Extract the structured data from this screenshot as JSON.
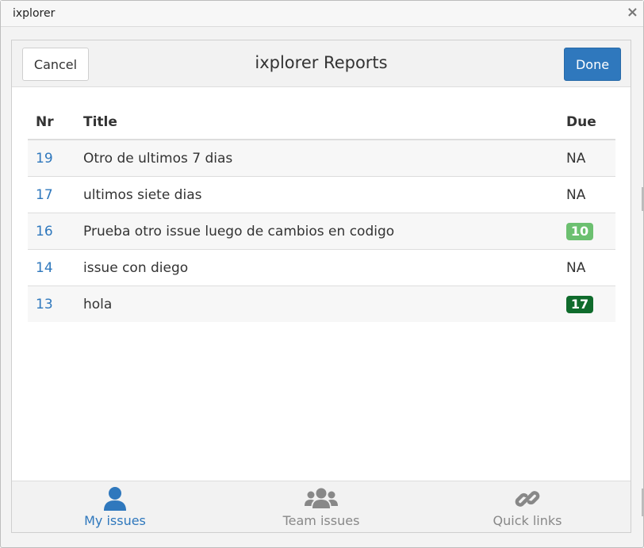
{
  "window": {
    "title": "ixplorer",
    "close_label": "×"
  },
  "modal": {
    "title": "ixplorer Reports",
    "cancel_label": "Cancel",
    "done_label": "Done"
  },
  "table": {
    "headers": {
      "nr": "Nr",
      "title": "Title",
      "due": "Due"
    },
    "rows": [
      {
        "nr": "19",
        "title": "Otro de ultimos 7 dias",
        "due": "NA"
      },
      {
        "nr": "17",
        "title": "ultimos siete dias",
        "due": "NA"
      },
      {
        "nr": "16",
        "title": "Prueba otro issue luego de cambios en codigo",
        "due": "10",
        "due_badge_color": "#6cc070"
      },
      {
        "nr": "14",
        "title": "issue con diego",
        "due": "NA"
      },
      {
        "nr": "13",
        "title": "hola",
        "due": "17",
        "due_badge_color": "#0f6b2c"
      }
    ]
  },
  "tabs": [
    {
      "label": "My issues",
      "icon": "user-icon",
      "active": true
    },
    {
      "label": "Team issues",
      "icon": "users-icon",
      "active": false
    },
    {
      "label": "Quick links",
      "icon": "link-icon",
      "active": false
    }
  ],
  "colors": {
    "accent": "#2f78bd",
    "inactive": "#888888"
  }
}
